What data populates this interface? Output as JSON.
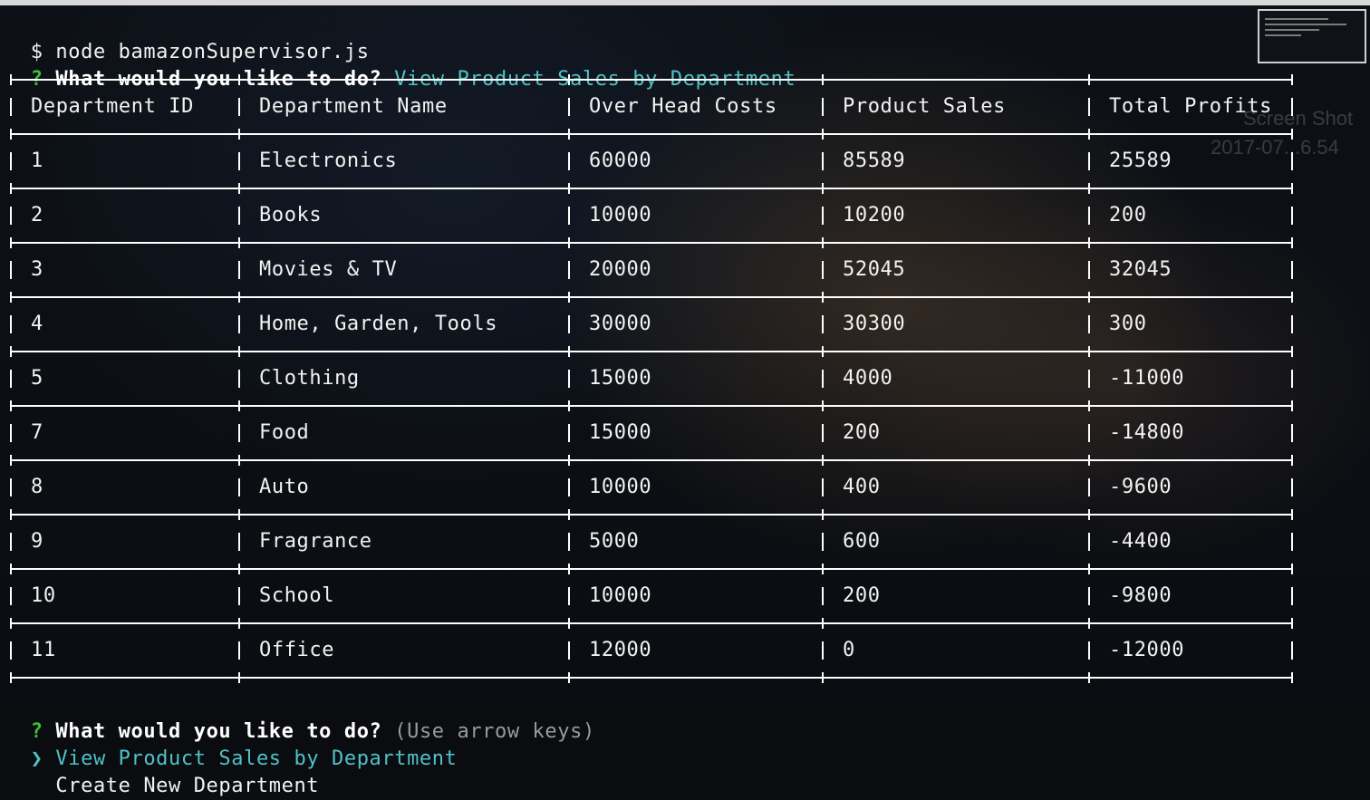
{
  "terminal": {
    "prompt_symbol": "$",
    "command": "node bamazonSupervisor.js"
  },
  "first_prompt": {
    "mark": "?",
    "question": "What would you like to do?",
    "answer": "View Product Sales by Department"
  },
  "table": {
    "headers": [
      "Department ID",
      "Department Name",
      "Over Head Costs",
      "Product Sales",
      "Total Profits"
    ],
    "rows": [
      [
        "1",
        "Electronics",
        "60000",
        "85589",
        "25589"
      ],
      [
        "2",
        "Books",
        "10000",
        "10200",
        "200"
      ],
      [
        "3",
        "Movies & TV",
        "20000",
        "52045",
        "32045"
      ],
      [
        "4",
        "Home, Garden, Tools",
        "30000",
        "30300",
        "300"
      ],
      [
        "5",
        "Clothing",
        "15000",
        "4000",
        "-11000"
      ],
      [
        "7",
        "Food",
        "15000",
        "200",
        "-14800"
      ],
      [
        "8",
        "Auto",
        "10000",
        "400",
        "-9600"
      ],
      [
        "9",
        "Fragrance",
        "5000",
        "600",
        "-4400"
      ],
      [
        "10",
        "School",
        "10000",
        "200",
        "-9800"
      ],
      [
        "11",
        "Office",
        "12000",
        "0",
        "-12000"
      ]
    ]
  },
  "second_prompt": {
    "mark": "?",
    "question": "What would you like to do?",
    "hint": "(Use arrow keys)"
  },
  "menu": {
    "pointer": "❯",
    "items": [
      "View Product Sales by Department",
      "Create New Department"
    ],
    "selected_index": 0
  },
  "desktop_ghost": {
    "label_line1": "Screen Shot",
    "label_line2": "2017-07...6.54"
  },
  "colors": {
    "question_mark": "#3bbf3b",
    "answer": "#4ec3c8",
    "hint": "#9a9a9a",
    "table_border": "#ffffff"
  }
}
